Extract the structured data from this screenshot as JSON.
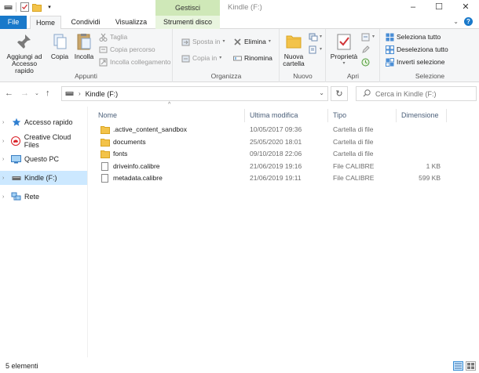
{
  "window": {
    "title": "Kindle (F:)",
    "context_tab_group": "Gestisci"
  },
  "tabs": {
    "file": "File",
    "home": "Home",
    "share": "Condividi",
    "view": "Visualizza",
    "drive_tools": "Strumenti disco"
  },
  "ribbon": {
    "clipboard": {
      "label": "Appunti",
      "pin_line1": "Aggiungi ad",
      "pin_line2": "Accesso rapido",
      "copy": "Copia",
      "paste": "Incolla",
      "cut": "Taglia",
      "copy_path": "Copia percorso",
      "paste_shortcut": "Incolla collegamento"
    },
    "organize": {
      "label": "Organizza",
      "move_to": "Sposta in",
      "copy_to": "Copia in",
      "delete": "Elimina",
      "rename": "Rinomina"
    },
    "new": {
      "label": "Nuovo",
      "new_folder_line1": "Nuova",
      "new_folder_line2": "cartella"
    },
    "open": {
      "label": "Apri",
      "properties": "Proprietà"
    },
    "select": {
      "label": "Selezione",
      "select_all": "Seleziona tutto",
      "select_none": "Deseleziona tutto",
      "invert": "Inverti selezione"
    }
  },
  "address": {
    "path": "Kindle (F:)",
    "search_placeholder": "Cerca in Kindle (F:)"
  },
  "nav": {
    "items": [
      {
        "label": "Accesso rapido"
      },
      {
        "label": "Creative Cloud Files"
      },
      {
        "label": "Questo PC"
      },
      {
        "label": "Kindle (F:)"
      },
      {
        "label": "Rete"
      }
    ]
  },
  "columns": {
    "name": "Nome",
    "modified": "Ultima modifica",
    "type": "Tipo",
    "size": "Dimensione"
  },
  "files": [
    {
      "name": ".active_content_sandbox",
      "modified": "10/05/2017 09:36",
      "type": "Cartella di file",
      "size": "",
      "kind": "folder"
    },
    {
      "name": "documents",
      "modified": "25/05/2020 18:01",
      "type": "Cartella di file",
      "size": "",
      "kind": "folder"
    },
    {
      "name": "fonts",
      "modified": "09/10/2018 22:06",
      "type": "Cartella di file",
      "size": "",
      "kind": "folder"
    },
    {
      "name": "driveinfo.calibre",
      "modified": "21/06/2019 19:16",
      "type": "File CALIBRE",
      "size": "1 KB",
      "kind": "file"
    },
    {
      "name": "metadata.calibre",
      "modified": "21/06/2019 19:11",
      "type": "File CALIBRE",
      "size": "599 KB",
      "kind": "file"
    }
  ],
  "status": {
    "count": "5 elementi"
  },
  "colors": {
    "accent": "#1979ca",
    "context_tab": "#cfe8b8",
    "selection": "#cce8ff",
    "folder": "#f3c34a"
  }
}
